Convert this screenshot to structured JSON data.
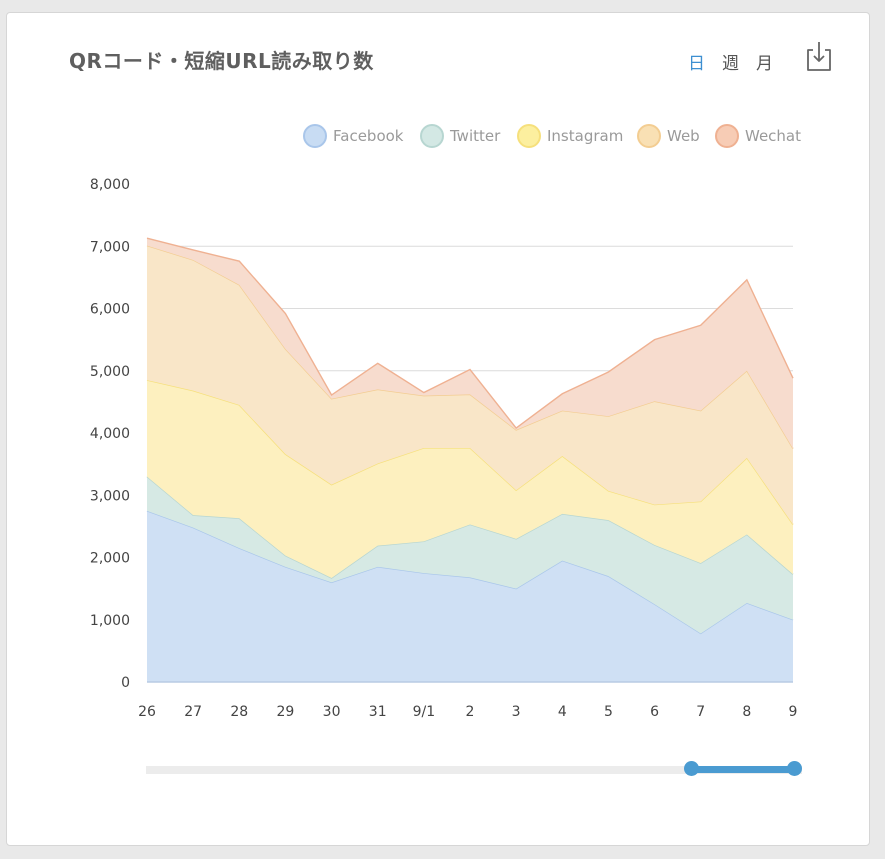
{
  "header": {
    "title": "QRコード・短縮URL読み取り数",
    "periods": [
      "日",
      "週",
      "月"
    ],
    "active_period": "日",
    "download_icon": "download-icon"
  },
  "colors": {
    "accent": "#4a9bd1",
    "Facebook": "#b8d2f0",
    "Twitter": "#c5e0dc",
    "Instagram": "#fbe9a0",
    "Web": "#f8dcb0",
    "Wechat": "#f6c4aa"
  },
  "chart_data": {
    "type": "area",
    "stacked": true,
    "title": "",
    "xlabel": "",
    "ylabel": "",
    "categories": [
      "26",
      "27",
      "28",
      "29",
      "30",
      "31",
      "9/1",
      "2",
      "3",
      "4",
      "5",
      "6",
      "7",
      "8",
      "9"
    ],
    "ylim": [
      0,
      8000
    ],
    "yticks": [
      "0",
      "1,000",
      "2,000",
      "3,000",
      "4,000",
      "5,000",
      "6,000",
      "7,000",
      "8,000"
    ],
    "grid": true,
    "legend_position": "top-right",
    "series": [
      {
        "name": "Facebook",
        "values": [
          2750,
          2480,
          2150,
          1850,
          1600,
          1850,
          1750,
          1680,
          1500,
          1950,
          1700,
          1250,
          780,
          1270,
          1000
        ]
      },
      {
        "name": "Twitter",
        "values": [
          550,
          200,
          480,
          180,
          70,
          340,
          510,
          850,
          800,
          750,
          900,
          950,
          1130,
          1100,
          730
        ]
      },
      {
        "name": "Instagram",
        "values": [
          1550,
          2000,
          1820,
          1630,
          1500,
          1320,
          1500,
          1230,
          780,
          930,
          470,
          650,
          990,
          1230,
          800
        ]
      },
      {
        "name": "Web",
        "values": [
          2160,
          2100,
          1930,
          1690,
          1380,
          1190,
          840,
          860,
          970,
          730,
          1200,
          1660,
          1460,
          1400,
          1220
        ]
      },
      {
        "name": "Wechat",
        "values": [
          120,
          160,
          380,
          570,
          60,
          420,
          50,
          400,
          30,
          270,
          710,
          990,
          1370,
          1460,
          1130
        ]
      }
    ]
  }
}
